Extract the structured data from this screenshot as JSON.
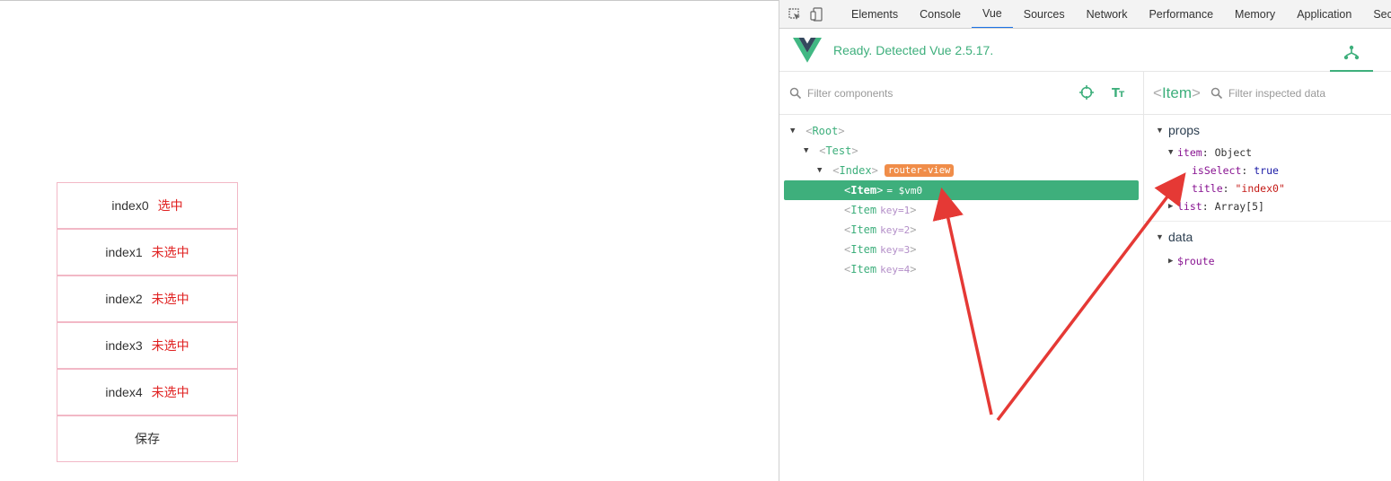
{
  "app": {
    "rows": [
      {
        "label": "index0",
        "status": "选中"
      },
      {
        "label": "index1",
        "status": "未选中"
      },
      {
        "label": "index2",
        "status": "未选中"
      },
      {
        "label": "index3",
        "status": "未选中"
      },
      {
        "label": "index4",
        "status": "未选中"
      }
    ],
    "save_label": "保存"
  },
  "devtools": {
    "tabs": [
      "Elements",
      "Console",
      "Vue",
      "Sources",
      "Network",
      "Performance",
      "Memory",
      "Application",
      "Security"
    ],
    "active_tab": "Vue"
  },
  "vue": {
    "ready_text": "Ready. Detected Vue 2.5.17.",
    "filter_placeholder": "Filter components",
    "tree": {
      "root": "Root",
      "test": "Test",
      "index": "Index",
      "index_badge": "router-view",
      "selected": {
        "name": "Item",
        "vm": "= $vm0"
      },
      "items": [
        {
          "name": "Item",
          "key": "key=1"
        },
        {
          "name": "Item",
          "key": "key=2"
        },
        {
          "name": "Item",
          "key": "key=3"
        },
        {
          "name": "Item",
          "key": "key=4"
        }
      ]
    },
    "inspector": {
      "title": "Item",
      "filter_placeholder": "Filter inspected data",
      "props_title": "props",
      "item_key": "item",
      "item_val": "Object",
      "isselect_key": "isSelect",
      "isselect_val": "true",
      "title_key": "title",
      "title_val": "\"index0\"",
      "list_key": "list",
      "list_val": "Array[5]",
      "data_title": "data",
      "route_key": "$route"
    }
  },
  "colors": {
    "vue_green": "#3eaf7c",
    "arrow_red": "#e53935",
    "row_border": "#f2b8c6",
    "status_red": "#e02020",
    "badge_orange": "#f08d49"
  }
}
